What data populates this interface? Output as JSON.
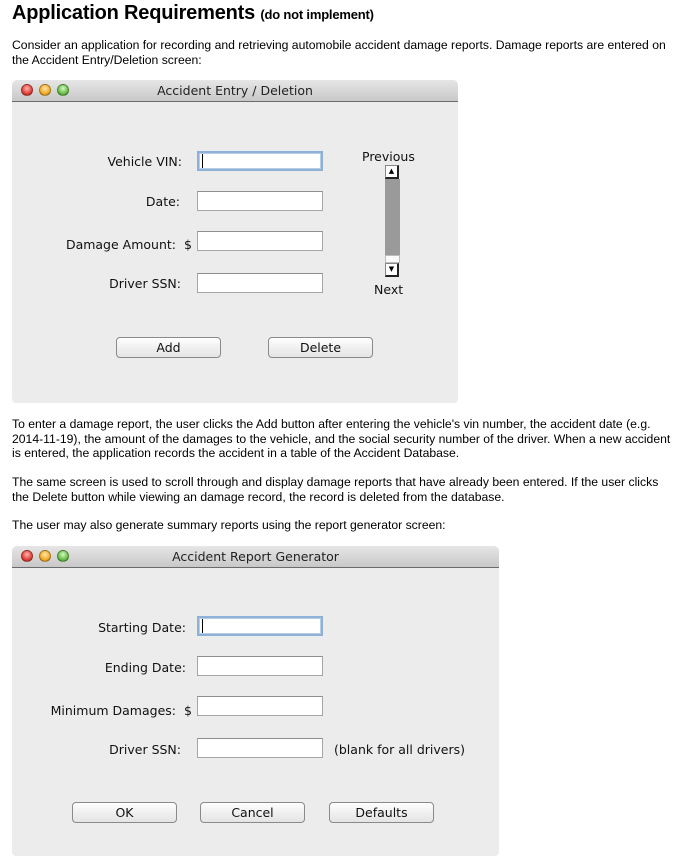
{
  "page": {
    "heading": "Application Requirements",
    "heading_note": "(do not implement)",
    "intro": "Consider an application for recording and retrieving automobile accident damage reports. Damage reports are entered on the Accident Entry/Deletion screen:",
    "para_add": "To enter a damage report, the user clicks the Add button after entering the vehicle's vin number, the accident date (e.g. 2014-11-19), the amount of the damages to the vehicle, and the social security number of the driver. When a new accident is entered, the application records the accident in a table of the Accident Database.",
    "para_delete": "The same screen is used to scroll through and display damage reports that have already been entered. If the user clicks the Delete button while viewing an damage record, the record is deleted from the database.",
    "para_report": "The user may also generate summary reports using the report generator screen:"
  },
  "entry_window": {
    "title": "Accident Entry / Deletion",
    "fields": [
      {
        "label": "Vehicle VIN:",
        "value": "",
        "prefix": ""
      },
      {
        "label": "Date:",
        "value": "",
        "prefix": ""
      },
      {
        "label": "Damage Amount:",
        "value": "",
        "prefix": "$"
      },
      {
        "label": "Driver SSN:",
        "value": "",
        "prefix": ""
      }
    ],
    "scroll": {
      "previous_label": "Previous",
      "next_label": "Next",
      "up_arrow": "▲",
      "down_arrow": "▼"
    },
    "buttons": {
      "add": "Add",
      "delete": "Delete"
    }
  },
  "report_window": {
    "title": "Accident Report Generator",
    "fields": [
      {
        "label": "Starting Date:",
        "value": "",
        "prefix": ""
      },
      {
        "label": "Ending Date:",
        "value": "",
        "prefix": ""
      },
      {
        "label": "Minimum Damages:",
        "value": "",
        "prefix": "$"
      },
      {
        "label": "Driver SSN:",
        "value": "",
        "prefix": "",
        "hint": "(blank for all drivers)"
      }
    ],
    "buttons": {
      "ok": "OK",
      "cancel": "Cancel",
      "defaults": "Defaults"
    }
  }
}
